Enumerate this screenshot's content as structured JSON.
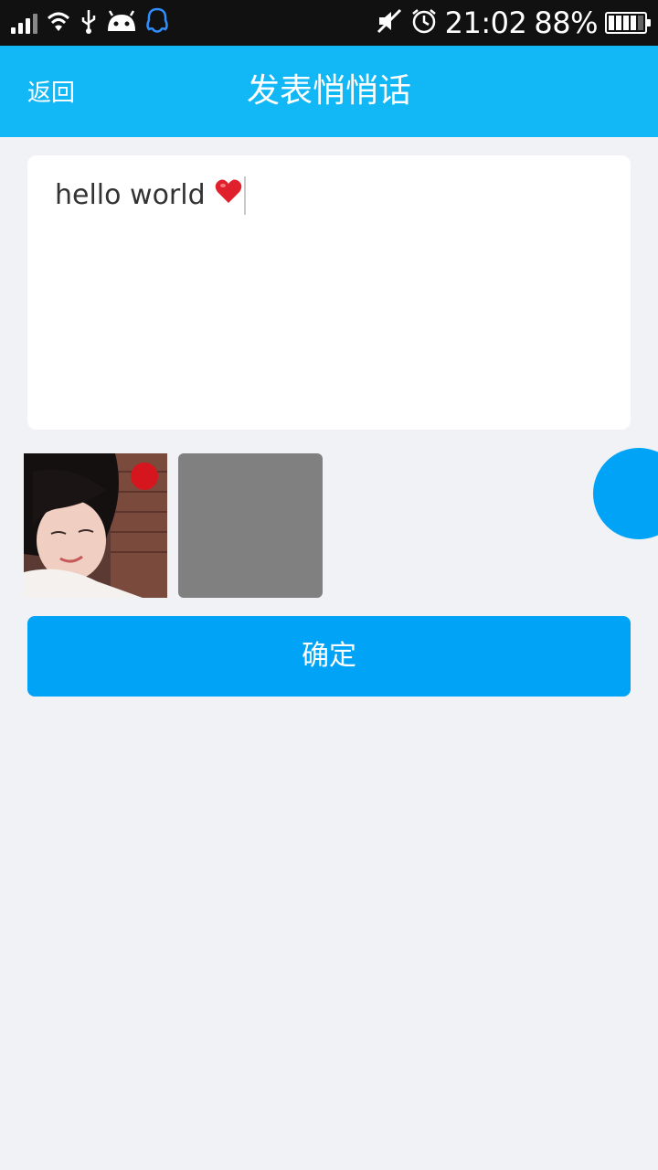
{
  "status_bar": {
    "time": "21:02",
    "battery_percent": "88%",
    "battery_level": 0.88,
    "icons": [
      "signal-icon",
      "wifi-icon",
      "usb-icon",
      "android-icon",
      "qq-icon",
      "mute-icon",
      "alarm-icon",
      "battery-icon"
    ]
  },
  "header": {
    "back_label": "返回",
    "title": "发表悄悄话"
  },
  "editor": {
    "value": "hello world",
    "emoji": "❤️"
  },
  "images": {
    "items": [
      "photo",
      "add-placeholder"
    ]
  },
  "actions": {
    "confirm_label": "确定"
  },
  "colors": {
    "app_bar": "#12b7f5",
    "primary": "#00a3f5",
    "background": "#f0f2f5",
    "badge": "#d5161f"
  }
}
